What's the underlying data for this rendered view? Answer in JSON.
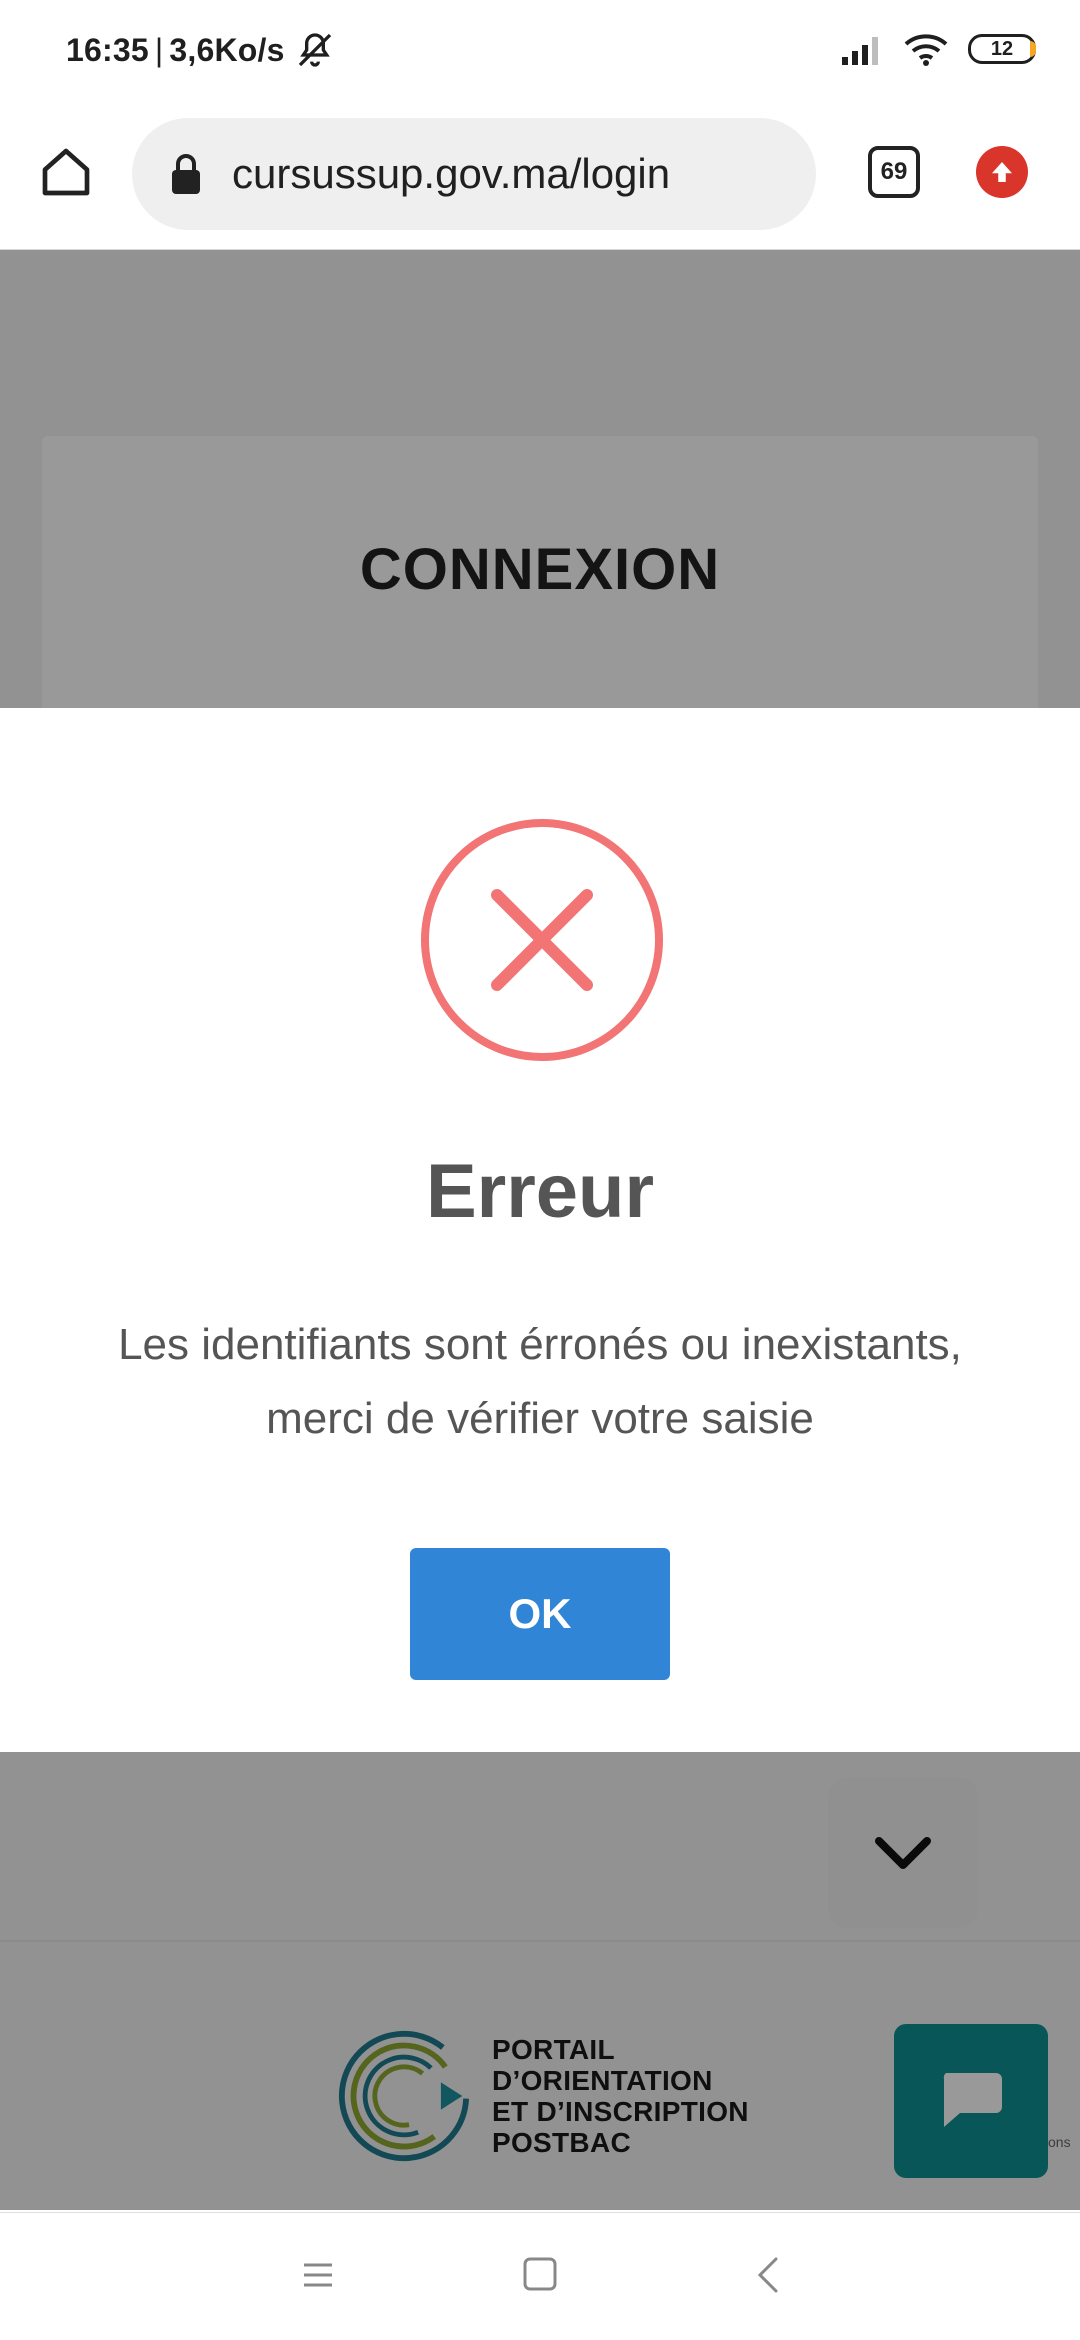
{
  "status_bar": {
    "time": "16:35",
    "separator": "|",
    "network_speed": "3,6Ko/s",
    "battery_level": "12",
    "icons": [
      "mute-icon",
      "signal-icon",
      "wifi-icon",
      "battery-icon"
    ]
  },
  "browser": {
    "url": "cursussup.gov.ma/login",
    "tab_count": "69",
    "icons": [
      "home-icon",
      "lock-icon",
      "tabs-icon",
      "update-icon"
    ]
  },
  "page": {
    "card_title": "CONNEXION",
    "logo_lines": [
      "PORTAIL",
      "D’ORIENTATION",
      "ET D’INSCRIPTION",
      "POSTBAC"
    ],
    "chat_partial_text": "ons"
  },
  "modal": {
    "title": "Erreur",
    "message": "Les identifiants sont érronés ou inexistants, merci de vérifier votre saisie",
    "ok_label": "OK",
    "icon": "error-x-icon"
  },
  "colors": {
    "accent_button": "#3085d6",
    "error_icon": "#f27474",
    "chat_button": "#0e8f92",
    "update_badge": "#d9352b"
  }
}
